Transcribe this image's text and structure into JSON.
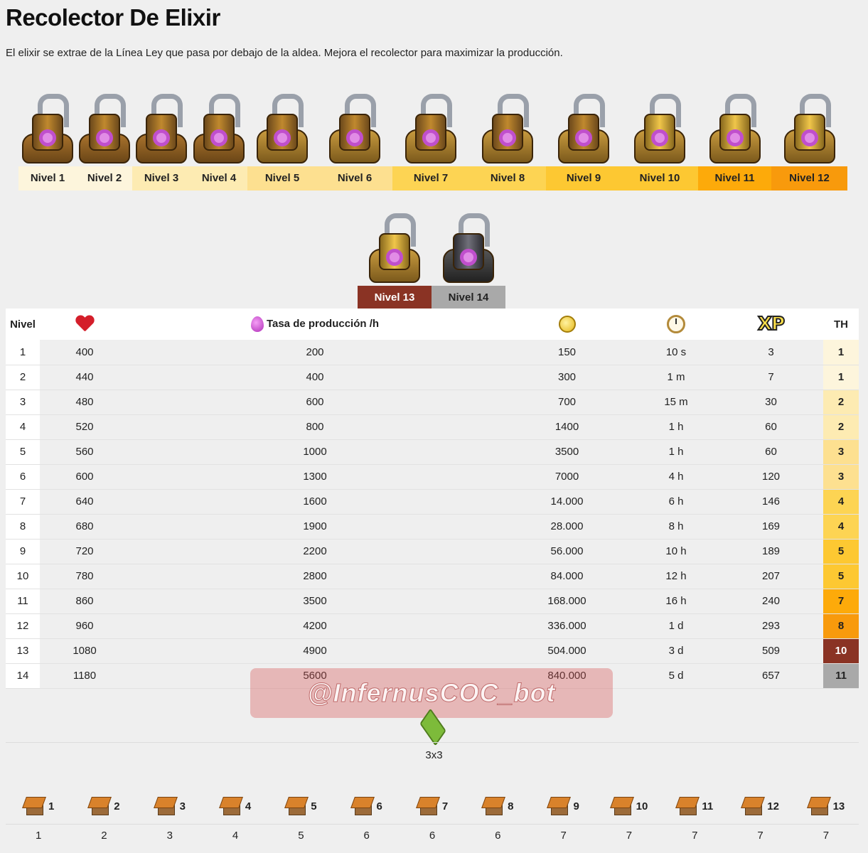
{
  "page": {
    "title": "Recolector De Elixir",
    "description": "El elixir se extrae de la Línea Ley que pasa por debajo de la aldea. Mejora el recolector para maximizar la producción."
  },
  "level_tabs_row1": [
    {
      "label": "Nivel 1",
      "color": "#fdf5dc"
    },
    {
      "label": "Nivel 2",
      "color": "#fdf5dc"
    },
    {
      "label": "Nivel 3",
      "color": "#fdebb2"
    },
    {
      "label": "Nivel 4",
      "color": "#fdebb2"
    },
    {
      "label": "Nivel 5",
      "color": "#fde090"
    },
    {
      "label": "Nivel 6",
      "color": "#fde090"
    },
    {
      "label": "Nivel 7",
      "color": "#fdd453"
    },
    {
      "label": "Nivel 8",
      "color": "#fdd453"
    },
    {
      "label": "Nivel 9",
      "color": "#fdc832"
    },
    {
      "label": "Nivel 10",
      "color": "#fdc832"
    },
    {
      "label": "Nivel 11",
      "color": "#fdaa0a"
    },
    {
      "label": "Nivel 12",
      "color": "#f89a0c"
    }
  ],
  "level_tabs_row2": [
    {
      "label": "Nivel 13",
      "color": "#8a3324",
      "text_color": "#ffffff"
    },
    {
      "label": "Nivel 14",
      "color": "#a9a9a9",
      "text_color": "#222222"
    }
  ],
  "table": {
    "headers": {
      "level": "Nivel",
      "hp_icon": "heart-icon",
      "production": "Tasa de producción /h",
      "cost_icon": "gold-coin-icon",
      "time_icon": "stopwatch-icon",
      "xp": "XP",
      "th": "TH"
    },
    "rows": [
      {
        "nivel": "1",
        "hp": "400",
        "rate": "200",
        "cost": "150",
        "time": "10 s",
        "xp": "3",
        "th": "1",
        "th_color": "#fdf5dc"
      },
      {
        "nivel": "2",
        "hp": "440",
        "rate": "400",
        "cost": "300",
        "time": "1 m",
        "xp": "7",
        "th": "1",
        "th_color": "#fdf5dc"
      },
      {
        "nivel": "3",
        "hp": "480",
        "rate": "600",
        "cost": "700",
        "time": "15 m",
        "xp": "30",
        "th": "2",
        "th_color": "#fdebb2"
      },
      {
        "nivel": "4",
        "hp": "520",
        "rate": "800",
        "cost": "1400",
        "time": "1 h",
        "xp": "60",
        "th": "2",
        "th_color": "#fdebb2"
      },
      {
        "nivel": "5",
        "hp": "560",
        "rate": "1000",
        "cost": "3500",
        "time": "1 h",
        "xp": "60",
        "th": "3",
        "th_color": "#fde090"
      },
      {
        "nivel": "6",
        "hp": "600",
        "rate": "1300",
        "cost": "7000",
        "time": "4 h",
        "xp": "120",
        "th": "3",
        "th_color": "#fde090"
      },
      {
        "nivel": "7",
        "hp": "640",
        "rate": "1600",
        "cost": "14.000",
        "time": "6 h",
        "xp": "146",
        "th": "4",
        "th_color": "#fdd453"
      },
      {
        "nivel": "8",
        "hp": "680",
        "rate": "1900",
        "cost": "28.000",
        "time": "8 h",
        "xp": "169",
        "th": "4",
        "th_color": "#fdd453"
      },
      {
        "nivel": "9",
        "hp": "720",
        "rate": "2200",
        "cost": "56.000",
        "time": "10 h",
        "xp": "189",
        "th": "5",
        "th_color": "#fdc832"
      },
      {
        "nivel": "10",
        "hp": "780",
        "rate": "2800",
        "cost": "84.000",
        "time": "12 h",
        "xp": "207",
        "th": "5",
        "th_color": "#fdc832"
      },
      {
        "nivel": "11",
        "hp": "860",
        "rate": "3500",
        "cost": "168.000",
        "time": "16 h",
        "xp": "240",
        "th": "7",
        "th_color": "#fdaa0a"
      },
      {
        "nivel": "12",
        "hp": "960",
        "rate": "4200",
        "cost": "336.000",
        "time": "1 d",
        "xp": "293",
        "th": "8",
        "th_color": "#f89a0c"
      },
      {
        "nivel": "13",
        "hp": "1080",
        "rate": "4900",
        "cost": "504.000",
        "time": "3 d",
        "xp": "509",
        "th": "10",
        "th_color": "#8a3324",
        "th_text": "#ffffff"
      },
      {
        "nivel": "14",
        "hp": "1180",
        "rate": "5600",
        "cost": "840.000",
        "time": "5 d",
        "xp": "657",
        "th": "11",
        "th_color": "#a9a9a9"
      }
    ]
  },
  "watermark": "@InfernusCOC_bot",
  "footprint": {
    "icon": "grass-tile-icon",
    "size": "3x3"
  },
  "town_halls": [
    {
      "th": "1",
      "max": "1"
    },
    {
      "th": "2",
      "max": "2"
    },
    {
      "th": "3",
      "max": "3"
    },
    {
      "th": "4",
      "max": "4"
    },
    {
      "th": "5",
      "max": "5"
    },
    {
      "th": "6",
      "max": "6"
    },
    {
      "th": "7",
      "max": "6"
    },
    {
      "th": "8",
      "max": "6"
    },
    {
      "th": "9",
      "max": "7"
    },
    {
      "th": "10",
      "max": "7"
    },
    {
      "th": "11",
      "max": "7"
    },
    {
      "th": "12",
      "max": "7"
    },
    {
      "th": "13",
      "max": "7"
    }
  ]
}
